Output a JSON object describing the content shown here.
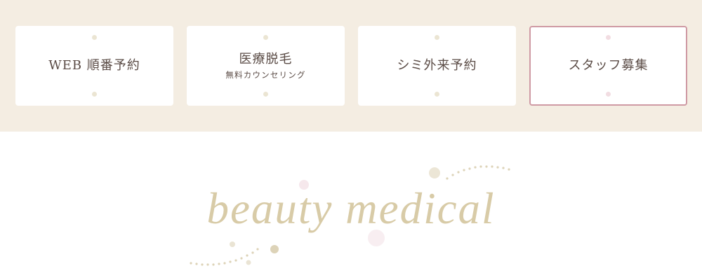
{
  "nav": {
    "cards": [
      {
        "label": "WEB 順番予約",
        "sub": ""
      },
      {
        "label": "医療脱毛",
        "sub": "無料カウンセリング"
      },
      {
        "label": "シミ外来予約",
        "sub": ""
      },
      {
        "label": "スタッフ募集",
        "sub": ""
      }
    ]
  },
  "brand": {
    "logo_text": "beauty medical"
  },
  "colors": {
    "band_background": "#f4ede2",
    "card_background": "#ffffff",
    "text": "#5a4b45",
    "highlight_border": "#cf9aa4",
    "logo": "#d8cba7"
  }
}
